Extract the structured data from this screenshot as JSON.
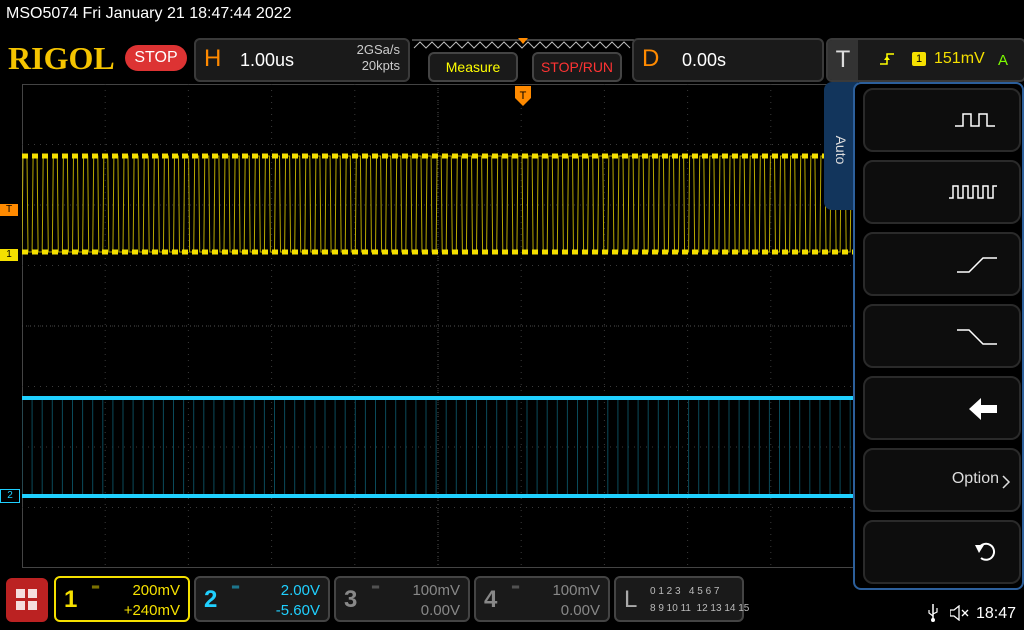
{
  "header": {
    "model_datetime": "MSO5074  Fri January 21 18:47:44 2022",
    "logo": "RIGOL",
    "run_state": "STOP"
  },
  "horizontal": {
    "letter": "H",
    "timebase": "1.00us",
    "sample_rate": "2GSa/s",
    "memory_depth": "20kpts"
  },
  "buttons": {
    "measure": "Measure",
    "stop_run": "STOP/RUN"
  },
  "delay": {
    "letter": "D",
    "value": "0.00s"
  },
  "trigger": {
    "letter": "T",
    "channel_num": "1",
    "level": "151mV",
    "mode": "A",
    "marker": "T"
  },
  "menu": {
    "auto_tab": "Auto",
    "option_label": "Option"
  },
  "channels": [
    {
      "num": "1",
      "scale": "200mV",
      "offset": "+240mV",
      "color": "#f5e000"
    },
    {
      "num": "2",
      "scale": "2.00V",
      "offset": "-5.60V",
      "color": "#20d0ff"
    },
    {
      "num": "3",
      "scale": "100mV",
      "offset": "0.00V",
      "color": "#888888"
    },
    {
      "num": "4",
      "scale": "100mV",
      "offset": "0.00V",
      "color": "#888888"
    }
  ],
  "logic": {
    "letter": "L",
    "row1": "0 1 2 3   4 5 6 7",
    "row2": "8 9 10 11  12 13 14 15"
  },
  "status": {
    "time": "18:47"
  },
  "colors": {
    "ch1": "#f5e000",
    "ch2": "#20d0ff",
    "accent_orange": "#ff8a00",
    "menu_border": "#2c5f9b"
  }
}
